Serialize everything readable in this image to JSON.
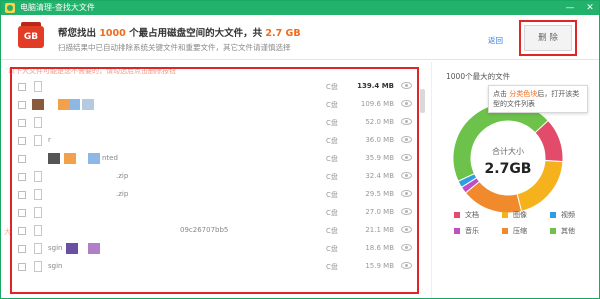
{
  "window": {
    "title": "电脑清理-查找大文件",
    "controls": [
      "—",
      "✕"
    ]
  },
  "header": {
    "icon_text": "GB",
    "headline_prefix": "帮您找出 ",
    "headline_count": "1000",
    "headline_middle": " 个最占用磁盘空间的大文件，共 ",
    "headline_total": "2.7 GB",
    "subline": "扫描结果中已自动排除系统关键文件和重要文件，其它文件请谨慎选择",
    "back_label": "返回",
    "delete_label": "删 除"
  },
  "list": {
    "notice": "以下大文件可能是您不需要的，请勾选后点击删除按钮",
    "notice2": "大",
    "rows": [
      {
        "name": "",
        "drive": "C盘",
        "size": "139.4 MB",
        "bold": true
      },
      {
        "name": "",
        "drive": "C盘",
        "size": "109.6 MB",
        "bold": false
      },
      {
        "name": "",
        "drive": "C盘",
        "size": "52.0 MB",
        "bold": false
      },
      {
        "name": "r",
        "drive": "C盘",
        "size": "36.0 MB",
        "bold": false
      },
      {
        "name": "nted",
        "drive": "C盘",
        "size": "35.9 MB",
        "bold": false
      },
      {
        "name": ".zip",
        "drive": "C盘",
        "size": "32.4 MB",
        "bold": false
      },
      {
        "name": ".zip",
        "drive": "C盘",
        "size": "29.5 MB",
        "bold": false
      },
      {
        "name": "",
        "drive": "C盘",
        "size": "27.0 MB",
        "bold": false
      },
      {
        "name": "09c26707bb5",
        "drive": "C盘",
        "size": "21.1 MB",
        "bold": false
      },
      {
        "name": "sgin",
        "drive": "C盘",
        "size": "18.6 MB",
        "bold": false
      },
      {
        "name": "sgin",
        "drive": "C盘",
        "size": "15.9 MB",
        "bold": false
      }
    ]
  },
  "summary": {
    "title": "1000个最大的文件",
    "center_label": "合计大小",
    "center_value": "2.7GB",
    "tooltip_prefix": "点击",
    "tooltip_accent": "分类色块",
    "tooltip_suffix": "后，打开该类型的文件列表",
    "legend": [
      {
        "label": "文档",
        "color": "#e34b6b"
      },
      {
        "label": "图像",
        "color": "#f6b21d"
      },
      {
        "label": "视频",
        "color": "#2f9ee0"
      },
      {
        "label": "音乐",
        "color": "#c04fc6"
      },
      {
        "label": "压缩",
        "color": "#f08a2c"
      },
      {
        "label": "其他",
        "color": "#6cc24a"
      }
    ]
  },
  "chart_data": {
    "type": "pie",
    "title": "",
    "categories": [
      "其他",
      "文档",
      "图像",
      "压缩",
      "音乐",
      "视频"
    ],
    "values": [
      45,
      13,
      20,
      18,
      2,
      2
    ]
  },
  "colors": {
    "titlebar": "#23b26b",
    "accent": "#f26a1b",
    "link": "#2d7fe0",
    "highlight": "#e12525"
  }
}
